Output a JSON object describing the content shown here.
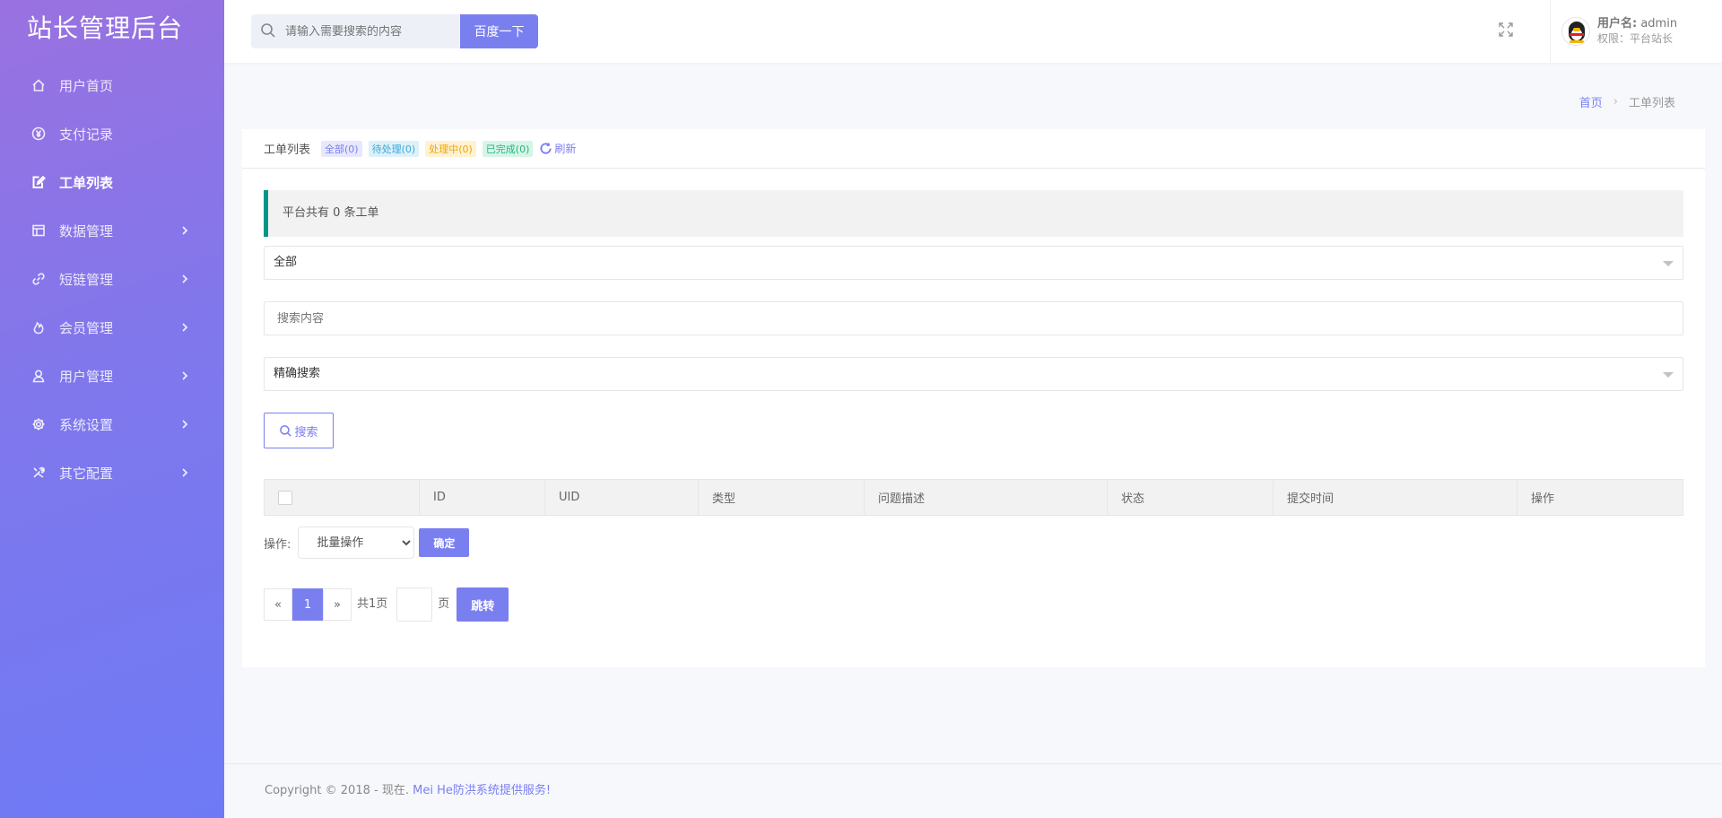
{
  "app": {
    "title": "站长管理后台"
  },
  "sidebar": {
    "items": [
      {
        "label": "用户首页",
        "icon": "home-icon",
        "active": false,
        "has_children": false
      },
      {
        "label": "支付记录",
        "icon": "yen-icon",
        "active": false,
        "has_children": false
      },
      {
        "label": "工单列表",
        "icon": "edit-icon",
        "active": true,
        "has_children": false
      },
      {
        "label": "数据管理",
        "icon": "table-icon",
        "active": false,
        "has_children": true
      },
      {
        "label": "短链管理",
        "icon": "link-icon",
        "active": false,
        "has_children": true
      },
      {
        "label": "会员管理",
        "icon": "fire-icon",
        "active": false,
        "has_children": true
      },
      {
        "label": "用户管理",
        "icon": "user-icon",
        "active": false,
        "has_children": true
      },
      {
        "label": "系统设置",
        "icon": "gear-icon",
        "active": false,
        "has_children": true
      },
      {
        "label": "其它配置",
        "icon": "tools-icon",
        "active": false,
        "has_children": true
      }
    ]
  },
  "header": {
    "search_placeholder": "请输入需要搜索的内容",
    "search_button": "百度一下",
    "user_label": "用户名:",
    "user_name": "admin",
    "role_text": "权限：平台站长"
  },
  "breadcrumb": {
    "home": "首页",
    "current": "工单列表"
  },
  "card": {
    "title": "工单列表",
    "filters": {
      "all": "全部(0)",
      "pending": "待处理(0)",
      "processing": "处理中(0)",
      "done": "已完成(0)"
    },
    "refresh": "刷新",
    "notice": "平台共有 0 条工单",
    "type_select": "全部",
    "search_placeholder": "搜索内容",
    "mode_select": "精确搜索",
    "search_button": "搜索",
    "table": {
      "columns": [
        "ID",
        "UID",
        "类型",
        "问题描述",
        "状态",
        "提交时间",
        "操作"
      ],
      "rows": []
    },
    "ops": {
      "label": "操作:",
      "batch_option": "批量操作",
      "confirm": "确定"
    },
    "pager": {
      "prev": "«",
      "current": "1",
      "next": "»",
      "total": "共1页",
      "unit": "页",
      "jump": "跳转"
    }
  },
  "footer": {
    "text": "Copyright © 2018 - 现在.",
    "link": "Mei He防洪系统提供服务!"
  },
  "colors": {
    "accent": "#7a7ff0",
    "sidebar_top": "#9a71e0",
    "sidebar_bottom": "#6e7af5",
    "notice_border": "#009688"
  }
}
